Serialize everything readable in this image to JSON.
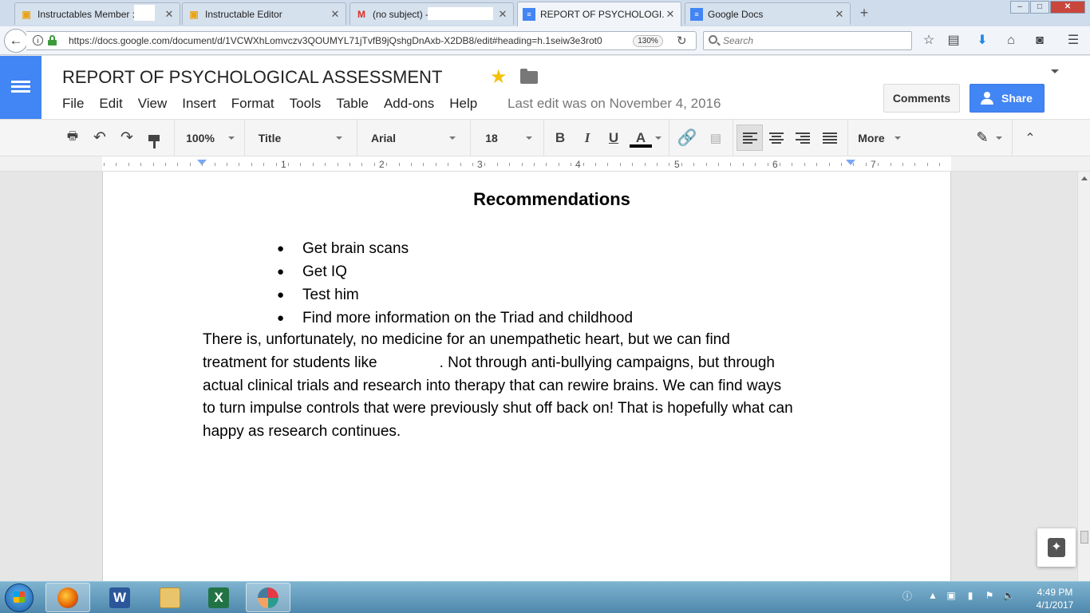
{
  "browser": {
    "tabs": [
      {
        "title": "Instructables Member :",
        "favicon": "robot-icon"
      },
      {
        "title": "Instructable Editor",
        "favicon": "robot-icon"
      },
      {
        "title": "(no subject) -",
        "favicon": "gmail-icon"
      },
      {
        "title": "REPORT OF PSYCHOLOGI...",
        "favicon": "google-docs-icon"
      },
      {
        "title": "Google Docs",
        "favicon": "google-docs-icon"
      }
    ],
    "close_glyph": "✕",
    "new_tab_glyph": "+",
    "url": "https://docs.google.com/document/d/1VCWXhLomvczv3QOUMYL71jTvfB9jQshgDnAxb-X2DB8/edit#heading=h.1seiw3e3rot0",
    "zoom": "130%",
    "search_placeholder": "Search"
  },
  "docs": {
    "title": "REPORT OF PSYCHOLOGICAL ASSESSMENT",
    "menu": [
      "File",
      "Edit",
      "View",
      "Insert",
      "Format",
      "Tools",
      "Table",
      "Add-ons",
      "Help"
    ],
    "last_edit": "Last edit was on November 4, 2016",
    "comments_label": "Comments",
    "share_label": "Share",
    "accent_color": "#4285f4"
  },
  "toolbar": {
    "zoom": "100%",
    "style": "Title",
    "font": "Arial",
    "font_size": "18",
    "bold": "B",
    "italic": "I",
    "underline": "U",
    "text_color": "A",
    "more_label": "More"
  },
  "ruler": {
    "numbers": [
      "1",
      "2",
      "3",
      "4",
      "5",
      "6",
      "7"
    ]
  },
  "document": {
    "heading": "Recommendations",
    "bullets": [
      "Get brain scans",
      "Get IQ",
      "Test him",
      "Find more information on the Triad and childhood"
    ],
    "paragraph_lines": [
      "There is, unfortunately, no medicine for an unempathetic heart, but we can find",
      "treatment for students like",
      ". Not through anti-bullying campaigns, but through",
      "actual clinical trials and research into therapy that can rewire brains. We can find ways",
      "to turn impulse controls that were previously shut off back on! That is hopefully what can",
      "happy as research continues."
    ]
  },
  "taskbar": {
    "apps": [
      "firefox-icon",
      "word-icon",
      "file-explorer-icon",
      "excel-icon",
      "paint-icon"
    ],
    "clock_time": "4:49 PM",
    "clock_date": "4/1/2017"
  }
}
